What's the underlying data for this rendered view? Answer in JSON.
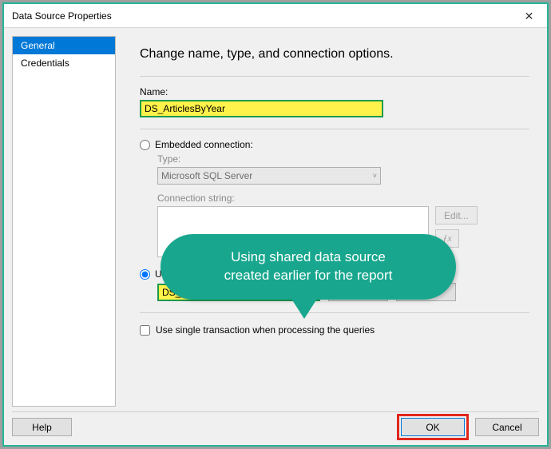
{
  "window": {
    "title": "Data Source Properties",
    "close_glyph": "✕"
  },
  "sidebar": {
    "items": [
      {
        "label": "General"
      },
      {
        "label": "Credentials"
      }
    ]
  },
  "heading": "Change name, type, and connection options.",
  "name": {
    "label": "Name:",
    "value": "DS_ArticlesByYear"
  },
  "embedded": {
    "radio_label": "Embedded connection:",
    "type_label": "Type:",
    "type_value": "Microsoft SQL Server",
    "connstr_label": "Connection string:",
    "edit_btn": "Edit..."
  },
  "shared": {
    "radio_label": "Use shared data source reference",
    "value": "DS_SQLDevBlogV5",
    "edit_btn": "Edit...",
    "new_btn": "New..."
  },
  "single_tx_label": "Use single transaction when processing the queries",
  "callout": {
    "line1": "Using shared data source",
    "line2": "created earlier for the report"
  },
  "footer": {
    "help": "Help",
    "ok": "OK",
    "cancel": "Cancel"
  },
  "chevron": "˅"
}
